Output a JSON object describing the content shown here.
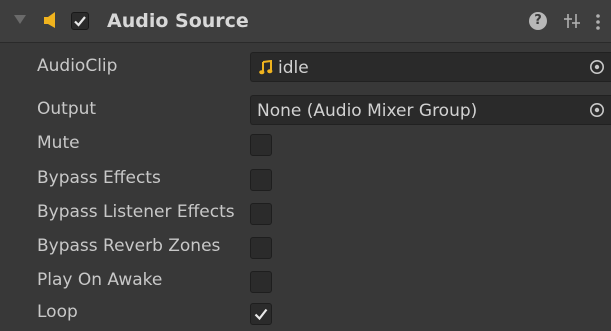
{
  "component": {
    "title": "Audio Source",
    "enabled": true,
    "help_icon": "help-icon",
    "help_glyph": "?",
    "preset_icon": "presets-icon",
    "menu_icon": "kebab-menu-icon",
    "icon": "audio-source-icon"
  },
  "fields": {
    "audioclip": {
      "label": "AudioClip",
      "value": "idle",
      "icon": "audio-clip-icon"
    },
    "output": {
      "label": "Output",
      "value": "None (Audio Mixer Group)"
    },
    "mute": {
      "label": "Mute",
      "checked": false
    },
    "bypass_effects": {
      "label": "Bypass Effects",
      "checked": false
    },
    "bypass_listener": {
      "label": "Bypass Listener Effects",
      "checked": false
    },
    "bypass_reverb": {
      "label": "Bypass Reverb Zones",
      "checked": false
    },
    "play_on_awake": {
      "label": "Play On Awake",
      "checked": false
    },
    "loop": {
      "label": "Loop",
      "checked": true
    }
  },
  "colors": {
    "background": "#383838",
    "header": "#3e3e3e",
    "field": "#2a2a2a",
    "accent_icon": "#f0b31e"
  }
}
